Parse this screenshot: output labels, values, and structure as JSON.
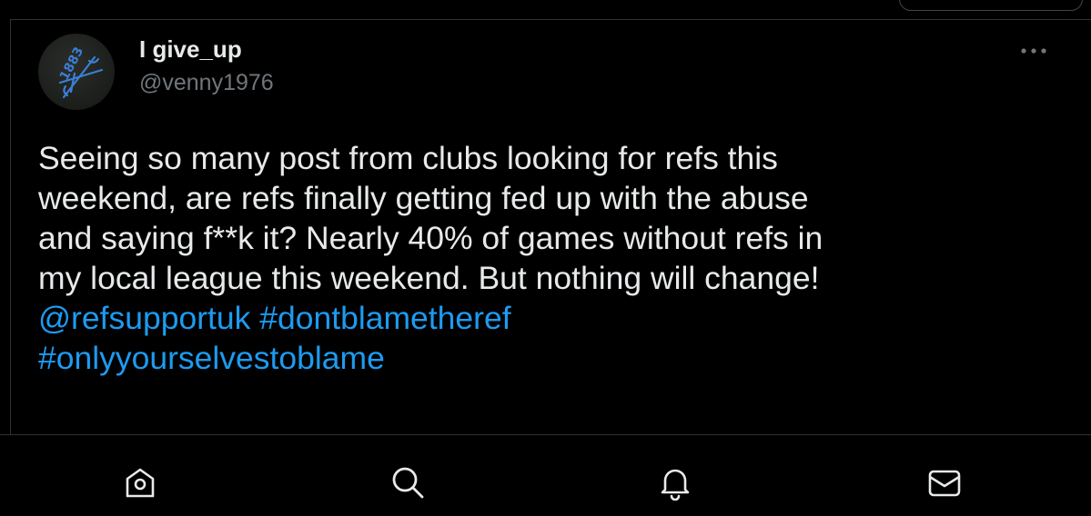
{
  "tweet": {
    "author_name": "I give_up",
    "author_handle": "@venny1976",
    "avatar_text": "1883",
    "body_lines": [
      "Seeing so many post from clubs looking for refs this",
      "weekend,  are refs finally getting fed up with the abuse",
      "and saying f**k it? Nearly 40% of games without refs in",
      "my local league this weekend. But nothing will change!"
    ],
    "mention": "@refsupportuk",
    "hashtags": [
      "#dontblametheref",
      "#onlyyourselvestoblame"
    ],
    "more_icon": "ellipsis-icon"
  },
  "tabbar": {
    "items": [
      {
        "icon": "home-icon"
      },
      {
        "icon": "search-icon"
      },
      {
        "icon": "bell-icon"
      },
      {
        "icon": "mail-icon"
      }
    ]
  },
  "colors": {
    "background": "#000000",
    "text_primary": "#e7e9ea",
    "text_secondary": "#71767b",
    "link": "#1d9bf0",
    "divider": "#2f3336"
  }
}
